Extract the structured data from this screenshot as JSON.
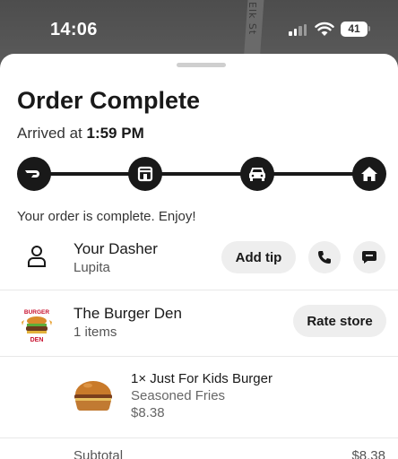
{
  "status_bar": {
    "time": "14:06",
    "battery": "41",
    "map_street": "Elk St"
  },
  "order": {
    "title": "Order Complete",
    "arrived_prefix": "Arrived at",
    "arrived_time": "1:59 PM",
    "progress_steps": [
      "dasher-logo-icon",
      "store-icon",
      "car-icon",
      "home-icon"
    ],
    "message": "Your order is complete. Enjoy!"
  },
  "dasher": {
    "label": "Your Dasher",
    "name": "Lupita",
    "add_tip_label": "Add tip",
    "call_icon": "phone-icon",
    "message_icon": "chat-icon"
  },
  "store": {
    "name": "The Burger Den",
    "items_count": "1 items",
    "rate_label": "Rate store",
    "logo_text_top": "BURGER",
    "logo_text_bottom": "DEN"
  },
  "items": [
    {
      "title": "1× Just For Kids Burger",
      "option": "Seasoned Fries",
      "price": "$8.38"
    }
  ],
  "summary": {
    "subtotal_label": "Subtotal",
    "subtotal_value": "$8.38"
  }
}
